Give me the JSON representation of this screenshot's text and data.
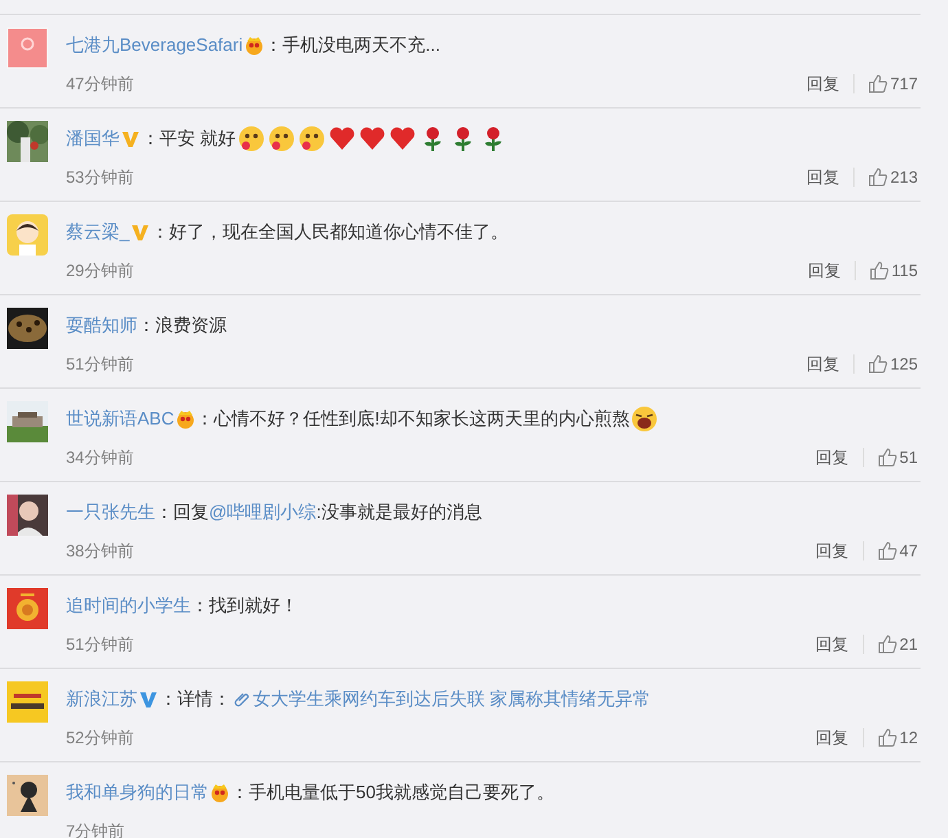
{
  "comments": [
    {
      "name": "七港九BeverageSafari",
      "badge": {
        "kind": "crown"
      },
      "content": [
        {
          "kind": "text",
          "text": "：手机没电两天不充..."
        }
      ],
      "time": "47分钟前",
      "reply": "回复",
      "likes": "717"
    },
    {
      "name": "潘国华",
      "badge": {
        "kind": "v_yellow"
      },
      "content": [
        {
          "kind": "text",
          "text": "：平安 就好"
        },
        {
          "kind": "blush"
        },
        {
          "kind": "blush"
        },
        {
          "kind": "blush"
        },
        {
          "kind": "heart"
        },
        {
          "kind": "heart"
        },
        {
          "kind": "heart"
        },
        {
          "kind": "rose"
        },
        {
          "kind": "rose"
        },
        {
          "kind": "rose"
        }
      ],
      "time": "53分钟前",
      "reply": "回复",
      "likes": "213"
    },
    {
      "name": "蔡云梁_",
      "badge": {
        "kind": "v_yellow"
      },
      "content": [
        {
          "kind": "text",
          "text": "：好了，现在全国人民都知道你心情不佳了。"
        }
      ],
      "time": "29分钟前",
      "reply": "回复",
      "likes": "115"
    },
    {
      "name": "耍酷知师",
      "content": [
        {
          "kind": "text",
          "text": " ：浪费资源"
        }
      ],
      "time": "51分钟前",
      "reply": "回复",
      "likes": "125"
    },
    {
      "name": "世说新语ABC",
      "badge": {
        "kind": "crown"
      },
      "content": [
        {
          "kind": "text",
          "text": "：心情不好？任性到底!却不知家长这两天里的内心煎熬"
        },
        {
          "kind": "crying"
        }
      ],
      "time": "34分钟前",
      "reply": "回复",
      "likes": "51"
    },
    {
      "name": "一只张先生",
      "content": [
        {
          "kind": "text",
          "text": " ：回复"
        },
        {
          "kind": "mention",
          "text": "@哔哩剧小综"
        },
        {
          "kind": "text",
          "text": ":没事就是最好的消息"
        }
      ],
      "time": "38分钟前",
      "reply": "回复",
      "likes": "47"
    },
    {
      "name": "追时间的小学生",
      "content": [
        {
          "kind": "text",
          "text": " ：找到就好！"
        }
      ],
      "time": "51分钟前",
      "reply": "回复",
      "likes": "21"
    },
    {
      "name": "新浪江苏",
      "badge": {
        "kind": "v_blue"
      },
      "content": [
        {
          "kind": "text",
          "text": "：详情："
        },
        {
          "kind": "web_link",
          "text": "女大学生乘网约车到达后失联 家属称其情绪无异常"
        }
      ],
      "time": "52分钟前",
      "reply": "回复",
      "likes": "12"
    },
    {
      "name": "我和单身狗的日常",
      "badge": {
        "kind": "crown"
      },
      "content": [
        {
          "kind": "text",
          "text": "：手机电量低于50我就感觉自己要死了。"
        }
      ],
      "time": "7分钟前"
    }
  ]
}
